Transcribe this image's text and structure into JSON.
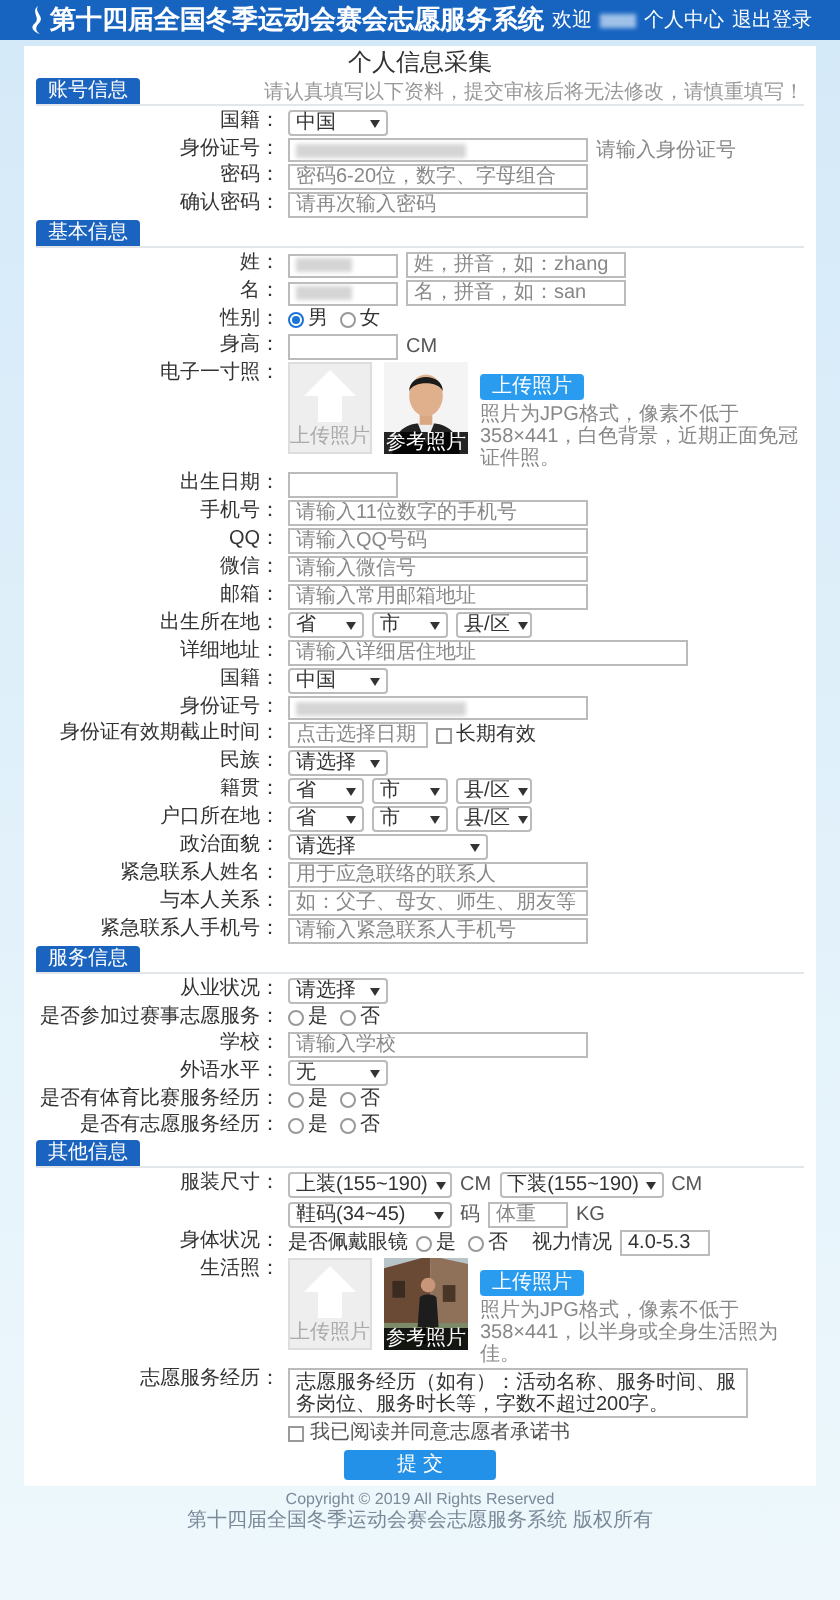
{
  "header": {
    "title": "第十四届全国冬季运动会赛会志愿服务系统",
    "greeting": "欢迎",
    "name_redacted": true,
    "links": [
      "个人中心",
      "退出登录"
    ]
  },
  "title": "个人信息采集",
  "sections": [
    {
      "heading": "账号信息",
      "note": "请认真填写以下资料，提交审核后将无法修改，请慎重填写！",
      "rows": [
        {
          "kind": "select",
          "label": "国籍：",
          "value": "中国"
        },
        {
          "kind": "input",
          "label": "身份证号：",
          "redacted": true,
          "note": "请输入身份证号"
        },
        {
          "kind": "input",
          "label": "密码：",
          "placeholder": "密码6-20位，数字、字母组合"
        },
        {
          "kind": "input",
          "label": "确认密码：",
          "placeholder": "请再次输入密码"
        }
      ]
    },
    {
      "heading": "基本信息",
      "rows": [
        {
          "kind": "pinyin",
          "label": "姓：",
          "redacted": true,
          "placeholder": "姓，拼音，如：zhang"
        },
        {
          "kind": "pinyin",
          "label": "名：",
          "redacted": true,
          "placeholder": "名，拼音，如：san"
        },
        {
          "kind": "radio",
          "label": "性别：",
          "options": [
            {
              "label": "男",
              "selected": true
            },
            {
              "label": "女",
              "selected": false
            }
          ]
        },
        {
          "kind": "short_input",
          "label": "身高：",
          "unit": "CM"
        },
        {
          "label": "电子一寸照：",
          "upload": "上传照片",
          "sample": "参考照片",
          "button": "上传照片",
          "note": "照片为JPG格式，像素不低于358×441，白色背景，近期正面免冠证件照。"
        },
        {
          "kind": "short_input",
          "label": "出生日期："
        },
        {
          "kind": "input",
          "label": "手机号：",
          "placeholder": "请输入11位数字的手机号"
        },
        {
          "kind": "input",
          "label": "QQ：",
          "placeholder": "请输入QQ号码"
        },
        {
          "kind": "input",
          "label": "微信：",
          "placeholder": "请输入微信号"
        },
        {
          "kind": "input",
          "label": "邮箱：",
          "placeholder": "请输入常用邮箱地址"
        },
        {
          "kind": "region",
          "label": "出生所在地：",
          "options": [
            "省",
            "市",
            "县/区"
          ]
        },
        {
          "kind": "long_input",
          "label": "详细地址：",
          "placeholder": "请输入详细居住地址"
        },
        {
          "kind": "select",
          "label": "国籍：",
          "value": "中国"
        },
        {
          "kind": "input",
          "label": "身份证号：",
          "redacted": true
        },
        {
          "kind": "date",
          "label": "身份证有效期截止时间：",
          "placeholder": "点击选择日期",
          "check": {
            "label": "长期有效",
            "checked": false
          }
        },
        {
          "kind": "select",
          "label": "民族：",
          "value": "请选择"
        },
        {
          "kind": "region",
          "label": "籍贯：",
          "options": [
            "省",
            "市",
            "县/区"
          ]
        },
        {
          "kind": "region",
          "label": "户口所在地：",
          "options": [
            "省",
            "市",
            "县/区"
          ]
        },
        {
          "kind": "wide_select",
          "label": "政治面貌：",
          "value": "请选择"
        },
        {
          "kind": "input",
          "label": "紧急联系人姓名：",
          "placeholder": "用于应急联络的联系人"
        },
        {
          "kind": "input",
          "label": "与本人关系：",
          "placeholder": "如：父子、母女、师生、朋友等"
        },
        {
          "kind": "input",
          "label": "紧急联系人手机号：",
          "placeholder": "请输入紧急联系人手机号"
        }
      ]
    },
    {
      "heading": "服务信息",
      "rows": [
        {
          "kind": "select",
          "label": "从业状况：",
          "value": "请选择"
        },
        {
          "kind": "radio",
          "label": "是否参加过赛事志愿服务：",
          "options": [
            {
              "label": "是",
              "selected": false
            },
            {
              "label": "否",
              "selected": false
            }
          ]
        },
        {
          "kind": "input",
          "label": "学校：",
          "placeholder": "请输入学校"
        },
        {
          "kind": "select",
          "label": "外语水平：",
          "value": "无"
        },
        {
          "kind": "radio",
          "label": "是否有体育比赛服务经历：",
          "options": [
            {
              "label": "是",
              "selected": false
            },
            {
              "label": "否",
              "selected": false
            }
          ]
        },
        {
          "kind": "radio",
          "label": "是否有志愿服务经历：",
          "options": [
            {
              "label": "是",
              "selected": false
            },
            {
              "label": "否",
              "selected": false
            }
          ]
        }
      ]
    },
    {
      "heading": "其他信息",
      "rows": [
        {
          "kind": "sizes",
          "label": "服装尺寸：",
          "items": [
            {
              "value": "上装(155~190)",
              "unit": "CM"
            },
            {
              "value": "下装(155~190)",
              "unit": "CM"
            },
            {
              "value": "鞋码(34~45)",
              "unit": "码"
            }
          ],
          "weight": {
            "placeholder": "体重",
            "unit": "KG"
          }
        },
        {
          "kind": "vision",
          "label": "身体状况：",
          "question": "是否佩戴眼镜",
          "options": [
            {
              "label": "是",
              "selected": false
            },
            {
              "label": "否",
              "selected": false
            }
          ],
          "sublabel": "视力情况",
          "value": "4.0-5.3"
        },
        {
          "label": "生活照：",
          "upload": "上传照片",
          "sample": "参考照片",
          "button": "上传照片",
          "note": "照片为JPG格式，像素不低于358×441，以半身或全身生活照为佳。"
        },
        {
          "kind": "textarea",
          "label": "志愿服务经历：",
          "value": "志愿服务经历（如有）：活动名称、服务时间、服务岗位、服务时长等，字数不超过200字。"
        }
      ]
    }
  ],
  "agreement": {
    "label": "我已阅读并同意志愿者承诺书",
    "checked": false
  },
  "submit": "提 交",
  "footer": [
    "Copyright © 2019 All Rights Reserved",
    "第十四届全国冬季运动会赛会志愿服务系统 版权所有"
  ]
}
